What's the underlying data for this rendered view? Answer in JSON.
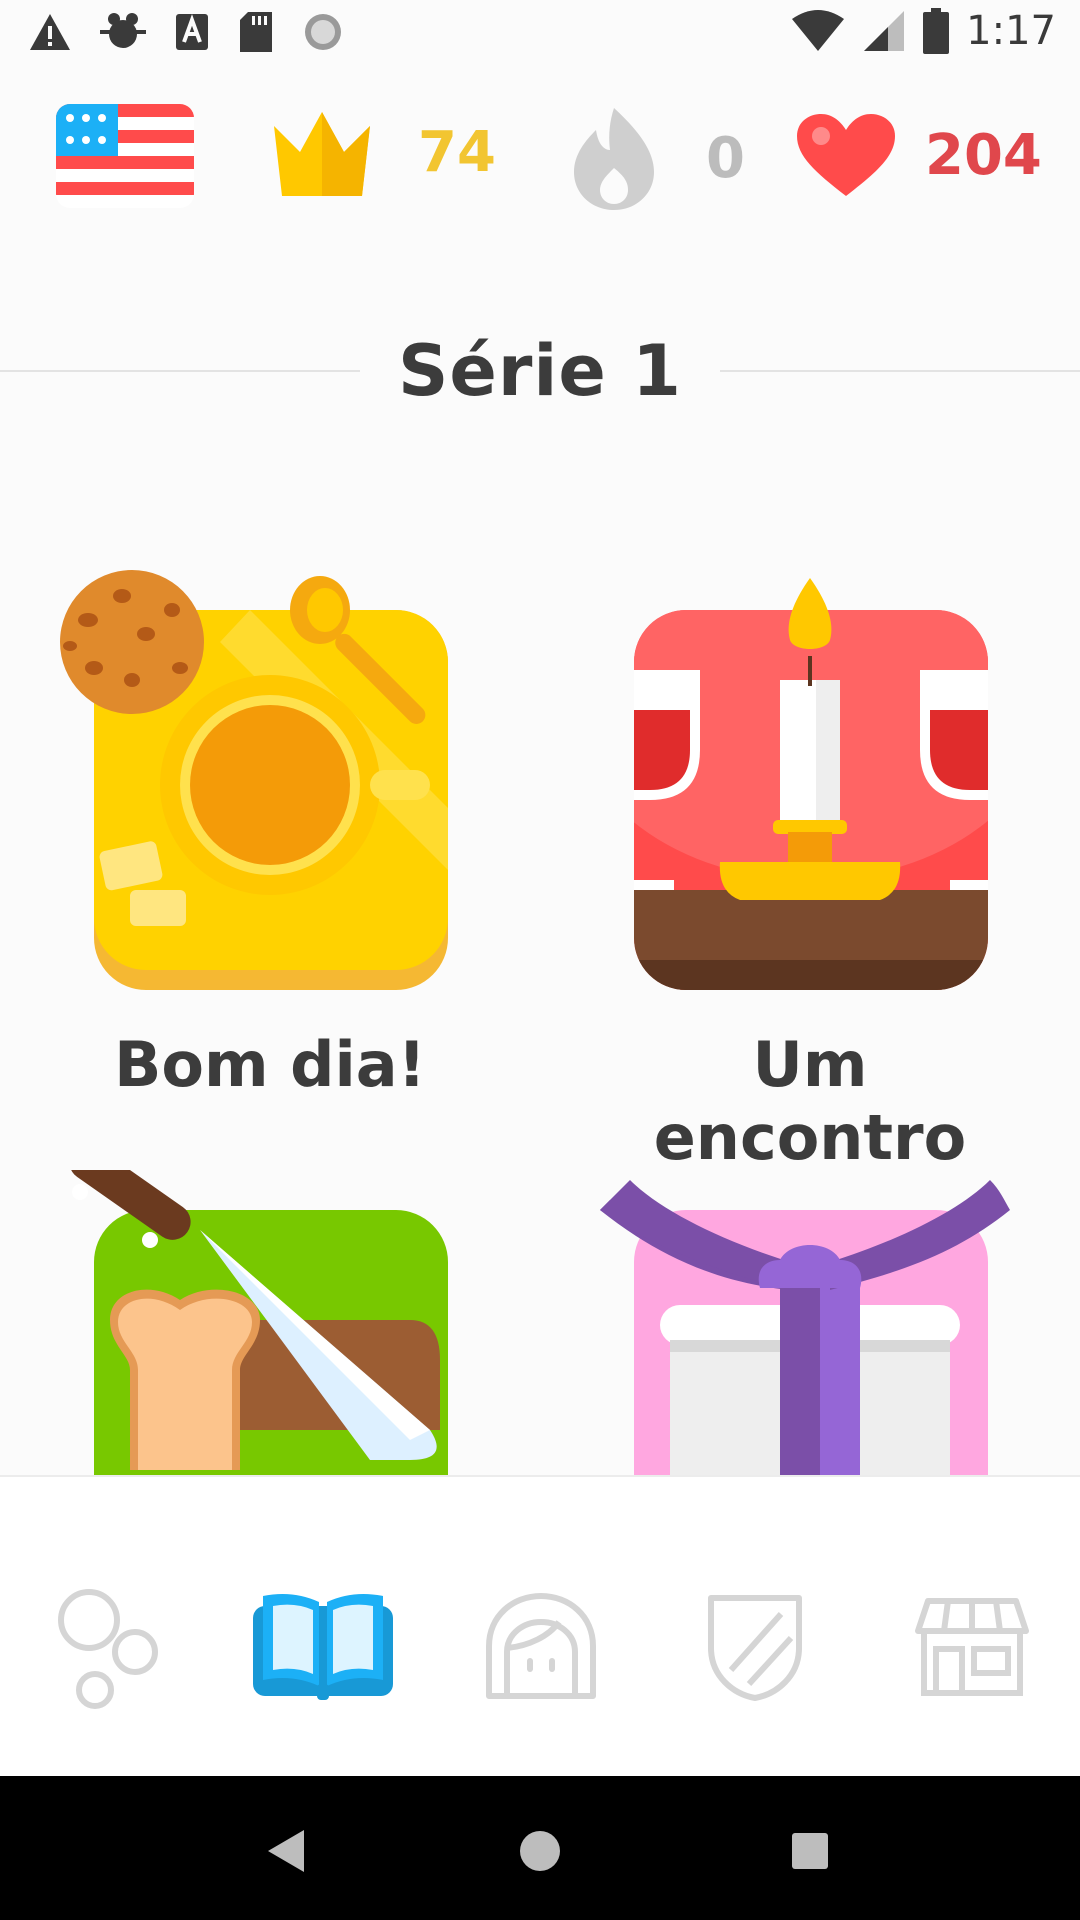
{
  "status_bar": {
    "time": "1:17",
    "left_icons": [
      "warning-icon",
      "bug-icon",
      "text-a-icon",
      "sd-card-icon",
      "sync-icon"
    ],
    "right_icons": [
      "wifi-icon",
      "cell-signal-icon",
      "battery-icon"
    ]
  },
  "top_stats": {
    "language": "flag-us-icon",
    "crowns": "74",
    "streak": "0",
    "hearts": "204",
    "colors": {
      "crowns": "#f2c531",
      "streak": "#bcbcbc",
      "hearts": "#e0474c"
    }
  },
  "section": {
    "title": "Série 1"
  },
  "skills": [
    {
      "label": "Bom dia!",
      "icon": "coffee-cup-icon"
    },
    {
      "label": "Um encontro",
      "icon": "candle-dinner-icon"
    },
    {
      "label": "",
      "icon": "bread-knife-icon"
    },
    {
      "label": "",
      "icon": "gift-box-icon"
    }
  ],
  "bottom_nav": [
    {
      "icon": "bubbles-icon",
      "active": false
    },
    {
      "icon": "book-icon",
      "active": true
    },
    {
      "icon": "profile-icon",
      "active": false
    },
    {
      "icon": "shield-icon",
      "active": false
    },
    {
      "icon": "shop-icon",
      "active": false
    }
  ],
  "colors": {
    "accent": "#1cb0f6",
    "inactive": "#d5d5d5"
  }
}
